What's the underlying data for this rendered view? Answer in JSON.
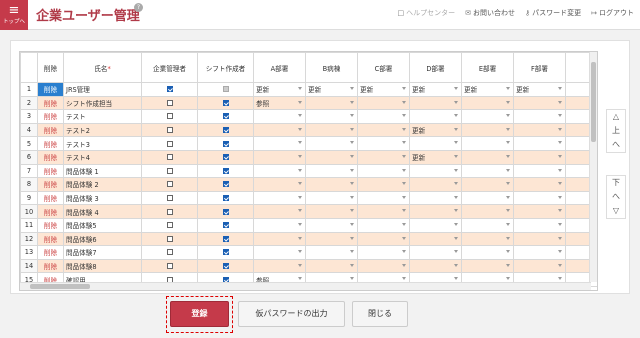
{
  "header": {
    "top_label": "トップへ",
    "title": "企業ユーザー管理",
    "help": "?",
    "links": [
      {
        "icon": "□",
        "label": "ヘルプセンター",
        "disabled": true
      },
      {
        "icon": "✉",
        "label": "お問い合わせ"
      },
      {
        "icon": "⚷",
        "label": "パスワード変更"
      },
      {
        "icon": "↦",
        "label": "ログアウト"
      }
    ]
  },
  "table": {
    "headers": {
      "del": "削除",
      "name": "氏名",
      "admin": "企業管理者",
      "shift": "シフト作成者",
      "depts": [
        "A部署",
        "B病棟",
        "C部署",
        "D部署",
        "E部署",
        "F部署"
      ]
    },
    "del_label": "削除",
    "rows": [
      {
        "no": "1",
        "name": "JRS管理",
        "admin": true,
        "shift": true,
        "shift_disabled": true,
        "depts": [
          "更新",
          "更新",
          "更新",
          "更新",
          "更新",
          "更新"
        ]
      },
      {
        "no": "2",
        "name": "シフト作成担当",
        "admin": false,
        "shift": true,
        "depts": [
          "参照",
          "",
          "",
          "",
          "",
          ""
        ]
      },
      {
        "no": "3",
        "name": "テスト",
        "admin": false,
        "shift": true,
        "depts": [
          "",
          "",
          "",
          "",
          "",
          ""
        ]
      },
      {
        "no": "4",
        "name": "テスト2",
        "admin": false,
        "shift": true,
        "depts": [
          "",
          "",
          "",
          "更新",
          "",
          ""
        ]
      },
      {
        "no": "5",
        "name": "テスト3",
        "admin": false,
        "shift": true,
        "depts": [
          "",
          "",
          "",
          "",
          "",
          ""
        ]
      },
      {
        "no": "6",
        "name": "テスト4",
        "admin": false,
        "shift": true,
        "depts": [
          "",
          "",
          "",
          "更新",
          "",
          ""
        ]
      },
      {
        "no": "7",
        "name": "問品体験 1",
        "admin": false,
        "shift": true,
        "depts": [
          "",
          "",
          "",
          "",
          "",
          ""
        ]
      },
      {
        "no": "8",
        "name": "問品体験 2",
        "admin": false,
        "shift": true,
        "depts": [
          "",
          "",
          "",
          "",
          "",
          ""
        ]
      },
      {
        "no": "9",
        "name": "問品体験 3",
        "admin": false,
        "shift": true,
        "depts": [
          "",
          "",
          "",
          "",
          "",
          ""
        ]
      },
      {
        "no": "10",
        "name": "問品体験 4",
        "admin": false,
        "shift": true,
        "depts": [
          "",
          "",
          "",
          "",
          "",
          ""
        ]
      },
      {
        "no": "11",
        "name": "問品体験5",
        "admin": false,
        "shift": true,
        "depts": [
          "",
          "",
          "",
          "",
          "",
          ""
        ]
      },
      {
        "no": "12",
        "name": "問品体験6",
        "admin": false,
        "shift": true,
        "depts": [
          "",
          "",
          "",
          "",
          "",
          ""
        ]
      },
      {
        "no": "13",
        "name": "問品体験7",
        "admin": false,
        "shift": true,
        "depts": [
          "",
          "",
          "",
          "",
          "",
          ""
        ]
      },
      {
        "no": "14",
        "name": "問品体験8",
        "admin": false,
        "shift": true,
        "depts": [
          "",
          "",
          "",
          "",
          "",
          ""
        ]
      },
      {
        "no": "15",
        "name": "確認用",
        "admin": false,
        "shift": true,
        "depts": [
          "参照",
          "",
          "",
          "",
          "",
          ""
        ]
      }
    ]
  },
  "side": {
    "up": [
      "△",
      "上",
      "へ"
    ],
    "down": [
      "下",
      "へ",
      "▽"
    ]
  },
  "buttons": {
    "register": "登録",
    "temp_password": "仮パスワードの出力",
    "close": "閉じる"
  }
}
